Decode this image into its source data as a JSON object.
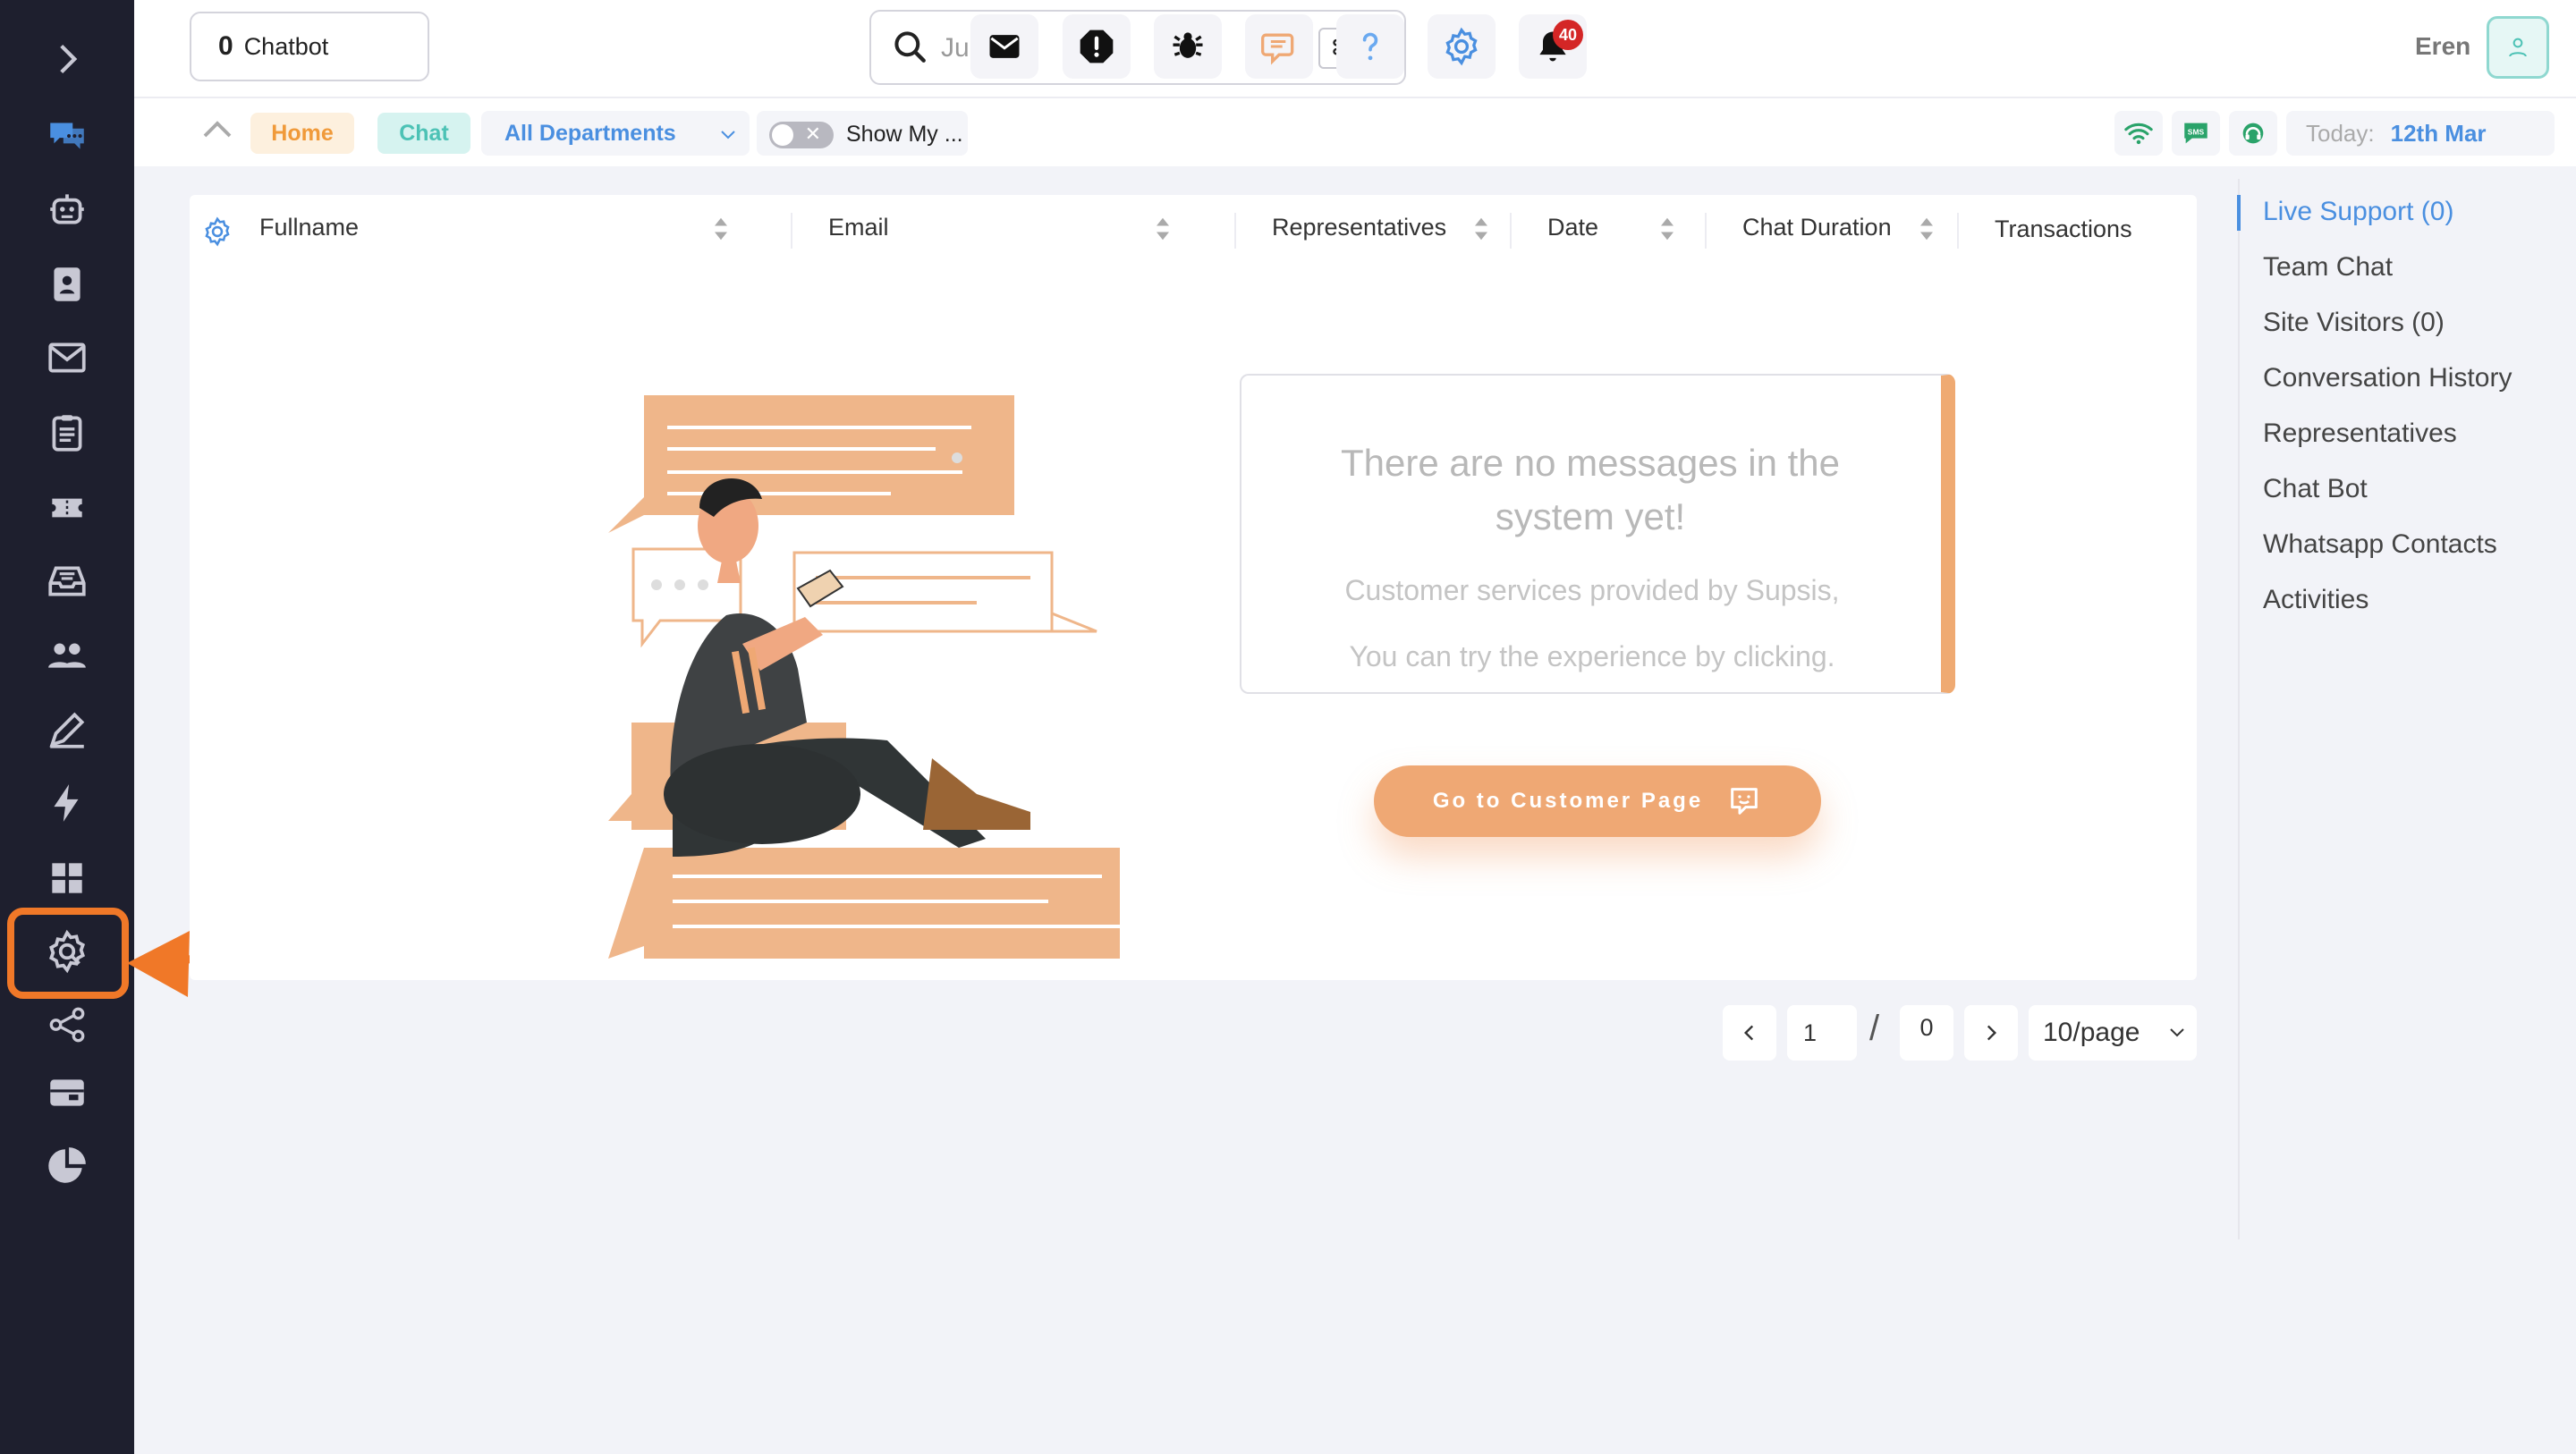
{
  "sidebar": {
    "items": [
      {
        "name": "expand-chevron-icon"
      },
      {
        "name": "live-chat-icon",
        "color": "#4a8fe0"
      },
      {
        "name": "chatbot-robot-icon"
      },
      {
        "name": "contacts-book-icon"
      },
      {
        "name": "mail-icon"
      },
      {
        "name": "clipboard-icon"
      },
      {
        "name": "ticket-icon"
      },
      {
        "name": "inbox-tray-icon"
      },
      {
        "name": "users-group-icon"
      },
      {
        "name": "pen-edit-icon"
      },
      {
        "name": "lightning-bolt-icon"
      },
      {
        "name": "dashboard-grid-icon"
      },
      {
        "name": "settings-gear-icon",
        "highlighted": true
      },
      {
        "name": "share-nodes-icon"
      },
      {
        "name": "id-card-icon"
      },
      {
        "name": "pie-chart-icon"
      }
    ],
    "highlight_color": "#f07828"
  },
  "header": {
    "chatbot_count": "0",
    "chatbot_label": "Chatbot",
    "search_placeholder": "Jump ⇥",
    "search_shortcut": "⌘ K",
    "notification_count": "40",
    "user_name": "Eren",
    "icons": [
      "mail-icon",
      "alert-icon",
      "bug-icon",
      "chat-bubble-icon",
      "help-icon",
      "settings-icon",
      "bell-icon"
    ]
  },
  "subheader": {
    "home_label": "Home",
    "chat_label": "Chat",
    "department_value": "All Departments",
    "show_mine_label": "Show My ...",
    "today_label": "Today:",
    "today_value": "12th Mar",
    "status_icons": [
      "wifi-icon",
      "sms-icon",
      "headset-icon"
    ]
  },
  "table": {
    "columns": [
      "Fullname",
      "Email",
      "Representatives",
      "Date",
      "Chat Duration",
      "Transactions"
    ]
  },
  "empty_state": {
    "title": "There are no messages in the system yet!",
    "line1": "Customer services provided by Supsis,",
    "line2": "You can try the experience by clicking.",
    "button_label": "Go to Customer Page"
  },
  "pagination": {
    "current_page": "1",
    "separator": "/",
    "total_pages": "0",
    "page_size": "10/page"
  },
  "right_panel": {
    "items": [
      {
        "label": "Live Support (0)",
        "active": true
      },
      {
        "label": "Team Chat"
      },
      {
        "label": "Site Visitors (0)"
      },
      {
        "label": "Conversation History"
      },
      {
        "label": "Representatives"
      },
      {
        "label": "Chat Bot"
      },
      {
        "label": "Whatsapp Contacts"
      },
      {
        "label": "Activities"
      }
    ]
  },
  "colors": {
    "accent_blue": "#4a8fe0",
    "accent_orange": "#efa874",
    "sidebar_bg": "#1e1f2e"
  }
}
